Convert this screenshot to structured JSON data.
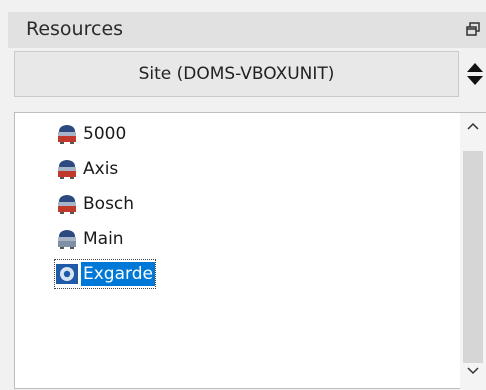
{
  "panel": {
    "title": "Resources",
    "site_selector": {
      "value": "Site (DOMS-VBOXUNIT)"
    }
  },
  "tree": {
    "items": [
      {
        "label": "5000",
        "icon": "server-icon"
      },
      {
        "label": "Axis",
        "icon": "server-icon"
      },
      {
        "label": "Bosch",
        "icon": "server-icon"
      },
      {
        "label": "Main",
        "icon": "server-icon"
      },
      {
        "label": "Exgarde",
        "icon": "gear-icon",
        "selected": true
      }
    ]
  },
  "colors": {
    "selection": "#0078d7",
    "panel_background": "#f1f1f1",
    "header_background": "#e1e1e1"
  }
}
